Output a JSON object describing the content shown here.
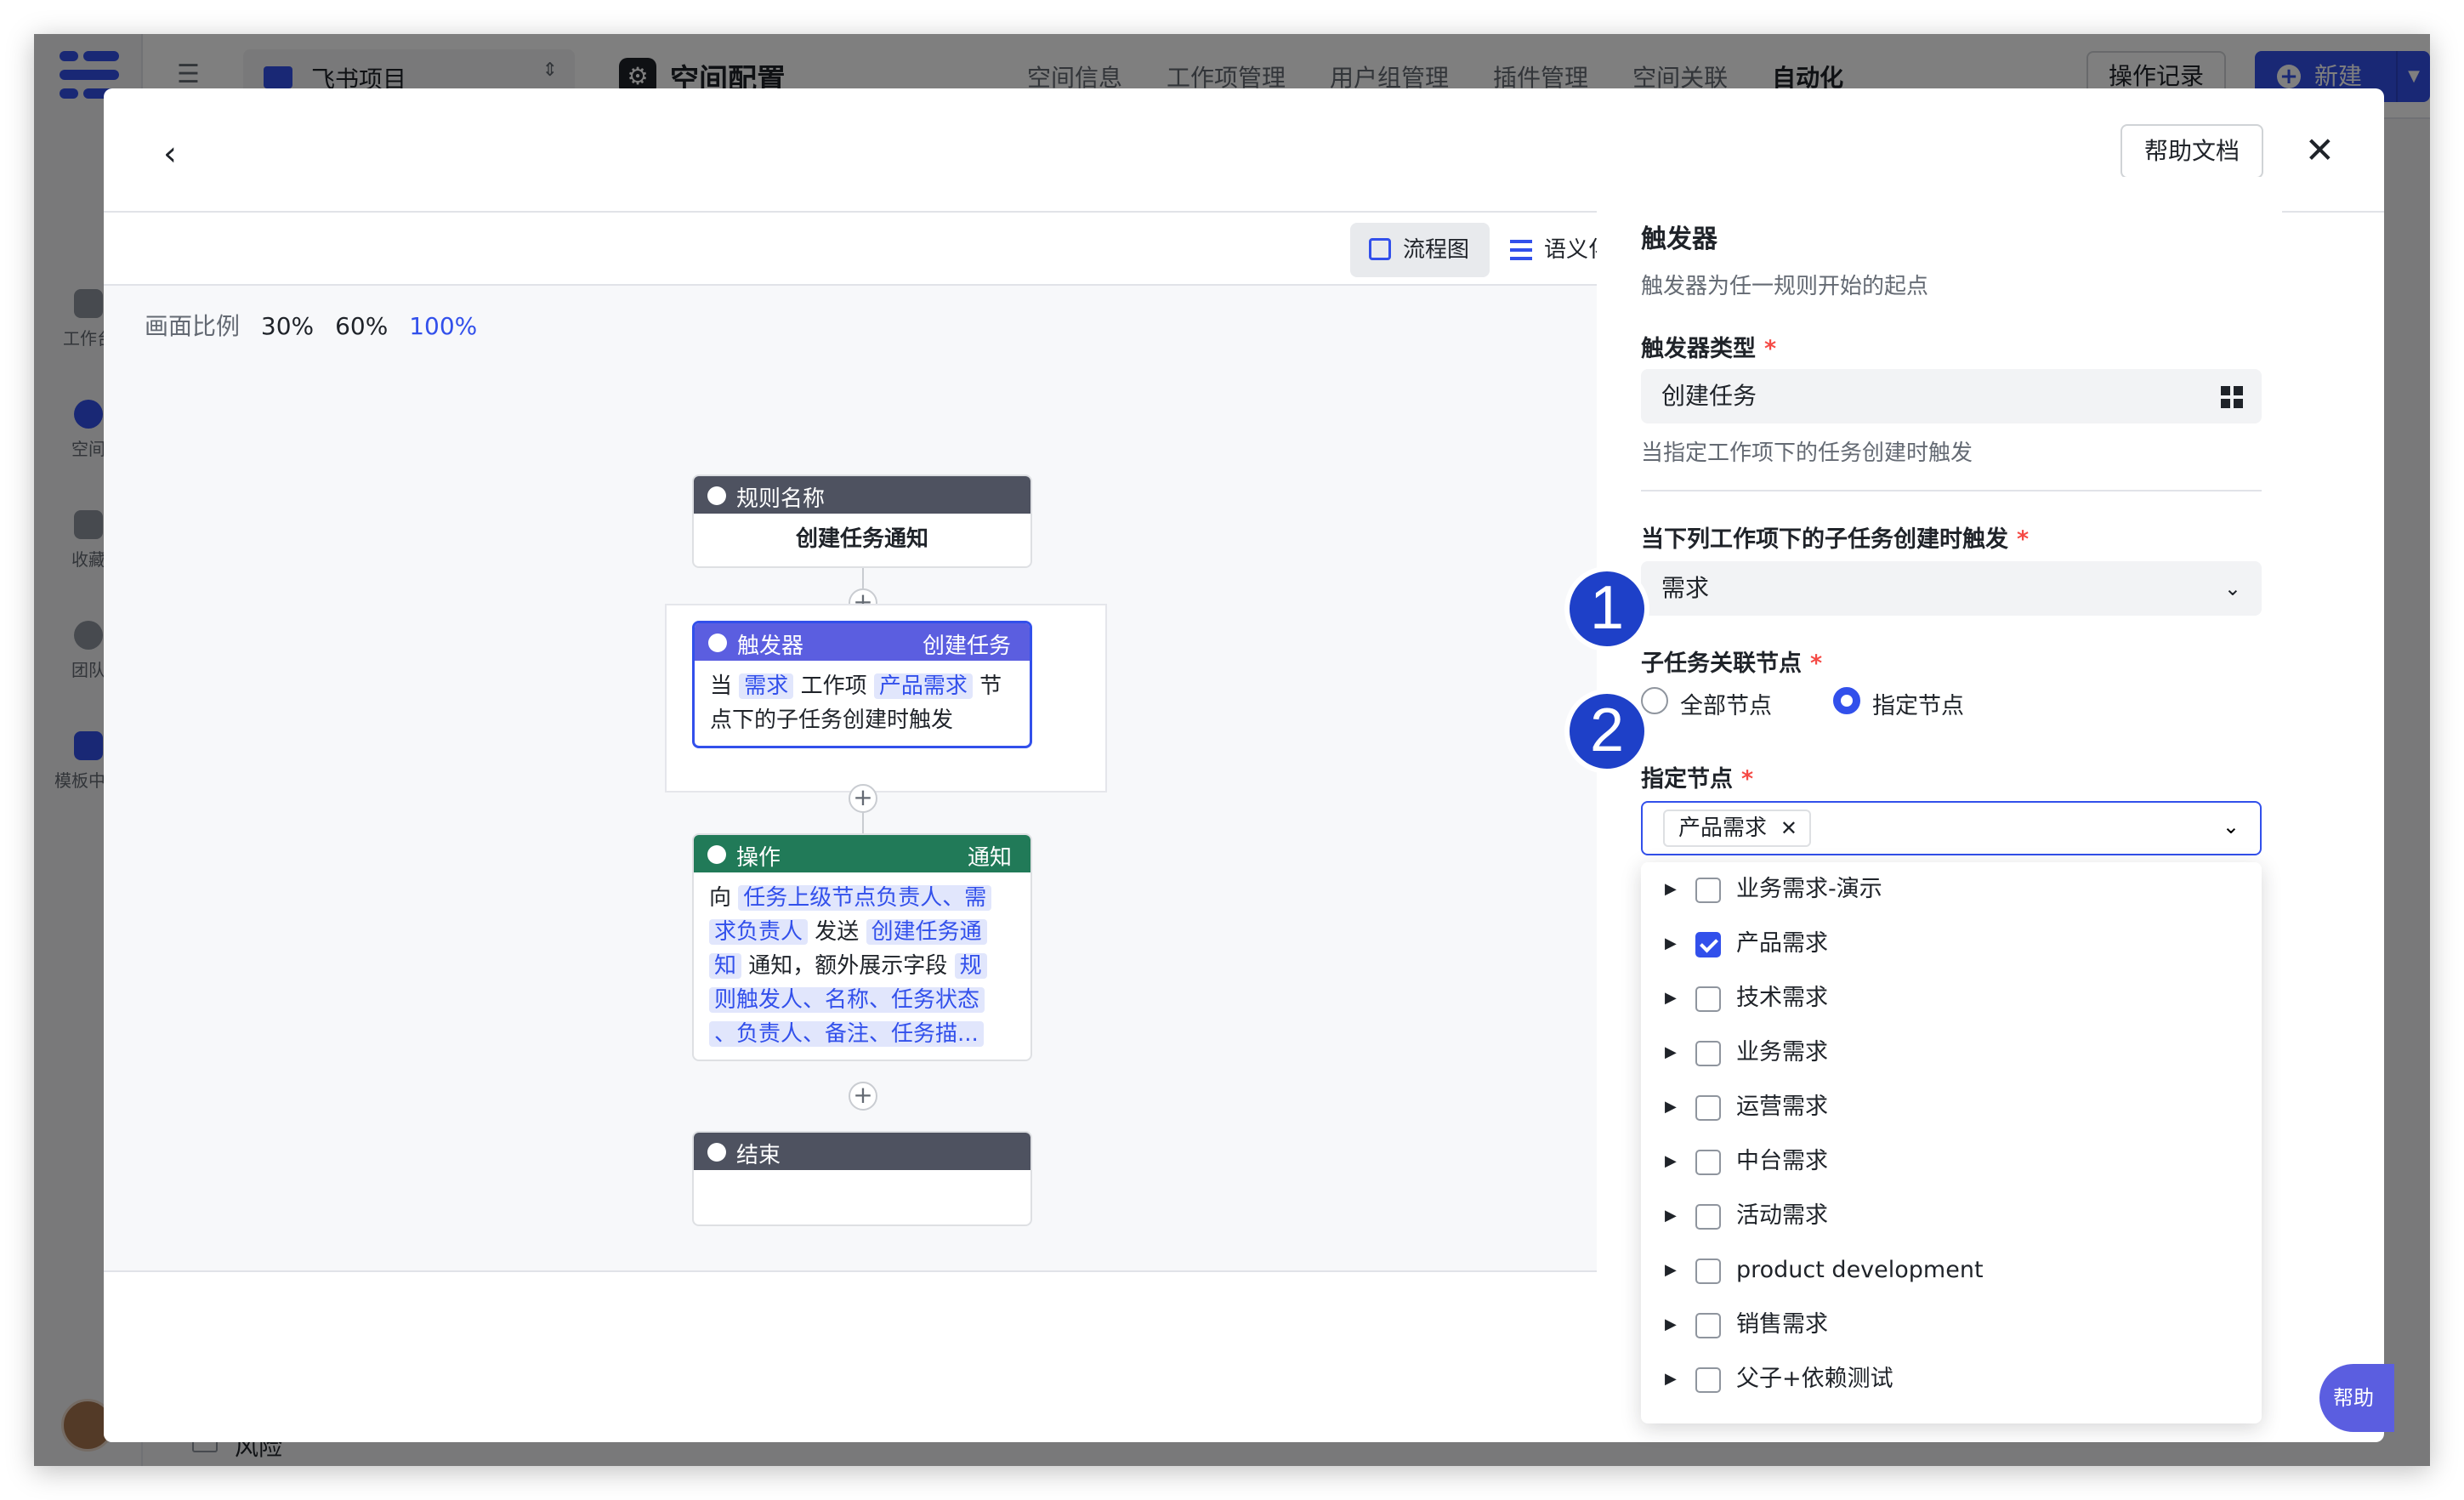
{
  "app": {
    "project_name": "飞书项目",
    "space_title": "空间配置",
    "tabs": [
      "空间信息",
      "工作项管理",
      "用户组管理",
      "插件管理",
      "空间关联",
      "自动化"
    ],
    "active_tab": "自动化",
    "log_label": "操作记录",
    "new_label": "新建",
    "nav": [
      "工作台",
      "空间",
      "收藏",
      "团队",
      "模板中心"
    ],
    "risk_label": "风险"
  },
  "modal": {
    "help_doc": "帮助文档",
    "view_flow": "流程图",
    "view_semantic": "语义化",
    "zoom_label": "画面比例",
    "zoom_options": [
      "30%",
      "60%",
      "100%"
    ],
    "zoom_current": "100%"
  },
  "flow": {
    "rule_header": "规则名称",
    "rule_name": "创建任务通知",
    "trigger_header": "触发器",
    "trigger_type": "创建任务",
    "trigger_body": {
      "p1": "当",
      "w1": "需求",
      "p2": "工作项",
      "w2": "产品需求",
      "p3": "节",
      "p4": "点下的子任务创建时触发"
    },
    "action_header": "操作",
    "action_type": "通知",
    "action_lines": [
      {
        "p": "向",
        "h": "任务上级节点负责人、需"
      },
      {
        "h": "求负责人",
        "p": "发送",
        "h2": "创建任务通"
      },
      {
        "h": "知",
        "p": "通知，额外展示字段",
        "h2": "规"
      },
      {
        "h": "则触发人、名称、任务状态"
      },
      {
        "h": "、负责人、备注、任务描..."
      }
    ],
    "end_header": "结束"
  },
  "panel": {
    "title": "触发器",
    "desc": "触发器为任一规则开始的起点",
    "type_label": "触发器类型",
    "type_value": "创建任务",
    "type_hint": "当指定工作项下的任务创建时触发",
    "workitem_label": "当下列工作项下的子任务创建时触发",
    "workitem_value": "需求",
    "node_label": "子任务关联节点",
    "radio_all": "全部节点",
    "radio_specified": "指定节点",
    "specified_label": "指定节点",
    "selected_tag": "产品需求",
    "options": [
      {
        "label": "业务需求-演示",
        "checked": false
      },
      {
        "label": "产品需求",
        "checked": true
      },
      {
        "label": "技术需求",
        "checked": false
      },
      {
        "label": "业务需求",
        "checked": false
      },
      {
        "label": "运营需求",
        "checked": false
      },
      {
        "label": "中台需求",
        "checked": false
      },
      {
        "label": "活动需求",
        "checked": false
      },
      {
        "label": "product development",
        "checked": false
      },
      {
        "label": "销售需求",
        "checked": false
      },
      {
        "label": "父子+依赖测试",
        "checked": false
      }
    ],
    "help_float": "帮助"
  },
  "annotations": {
    "badge1": "1",
    "badge2": "2"
  },
  "colors": {
    "accent": "#3250eb",
    "trigger": "#5b5ee0",
    "action": "#217a58",
    "dark_header": "#4e5260"
  }
}
